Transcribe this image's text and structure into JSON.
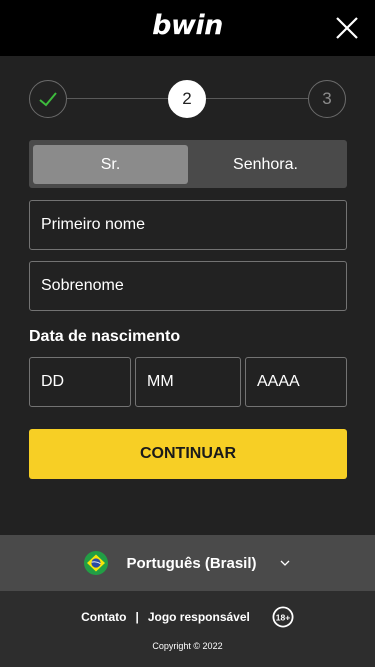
{
  "header": {
    "logo_text": "bwin",
    "close_icon": "close-icon"
  },
  "stepper": {
    "steps": [
      {
        "label": "",
        "state": "done",
        "icon": "check-icon"
      },
      {
        "label": "2",
        "state": "active"
      },
      {
        "label": "3",
        "state": "pending"
      }
    ]
  },
  "form": {
    "gender": {
      "options": [
        "Sr.",
        "Senhora."
      ],
      "selected": "Sr."
    },
    "first_name_placeholder": "Primeiro nome",
    "last_name_placeholder": "Sobrenome",
    "dob_label": "Data de nascimento",
    "dob_day_placeholder": "DD",
    "dob_month_placeholder": "MM",
    "dob_year_placeholder": "AAAA",
    "continue_label": "CONTINUAR"
  },
  "language": {
    "label": "Português (Brasil)",
    "flag_icon": "brazil-flag-icon",
    "chevron_icon": "chevron-down-icon"
  },
  "footer": {
    "contact": "Contato",
    "separator": "|",
    "responsible": "Jogo responsável",
    "age_badge": "18+",
    "copyright": "Copyright © 2022"
  },
  "colors": {
    "background": "#222222",
    "topbar": "#000000",
    "accent": "#f7cf25",
    "language_bar": "#4a4a4a",
    "footer": "#2d2d2d",
    "success": "#3dbb3d"
  }
}
